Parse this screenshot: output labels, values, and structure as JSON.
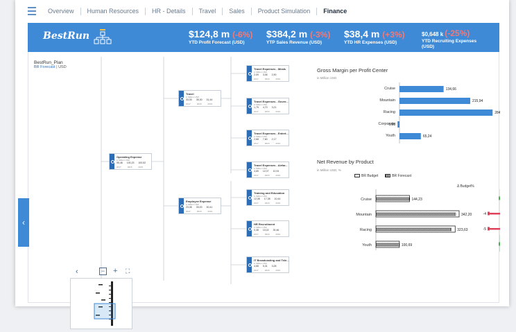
{
  "tabs": [
    "Overview",
    "Human Resources",
    "HR - Details",
    "Travel",
    "Sales",
    "Product Simulation",
    "Finance"
  ],
  "active_tab": "Finance",
  "banner": {
    "logo": "BestRun",
    "kpis": [
      {
        "value": "$124,8 m",
        "delta": "(-6%)",
        "label": "YTD Profit Forecast (USD)"
      },
      {
        "value": "$384,2 m",
        "delta": "(-3%)",
        "label": "YTP Sales Revenue (USD)"
      },
      {
        "value": "$38,4 m",
        "delta": "(+3%)",
        "label": "YTD HR Expenses (USD)"
      },
      {
        "value": "$0,648 k",
        "delta": "(-25%)",
        "label": "YTD Recruiting Expenses (USD)"
      }
    ]
  },
  "plan": {
    "title": "BestRun_Plan",
    "version": "BR Forecast",
    "currency": "USD"
  },
  "tree_nodes": [
    {
      "title": "Operating Expense",
      "sub": "in Million USD",
      "values": [
        "95,46",
        "100,23",
        "100,52"
      ],
      "years": [
        "2017",
        "2018",
        "2019"
      ]
    },
    {
      "title": "Travel",
      "sub": "in Million USD",
      "values": [
        "33,00",
        "35,30",
        "31,44"
      ],
      "years": [
        "2017",
        "2018",
        "2019"
      ]
    },
    {
      "title": "Employee Expense",
      "sub": "in Million USD",
      "values": [
        "23,06",
        "30,00",
        "30,41"
      ],
      "years": [
        "2017",
        "2018",
        "2019"
      ]
    },
    {
      "title": "Travel Expenses - Meals",
      "sub": "in Million USD",
      "values": [
        "2,09",
        "3,06",
        "2,90"
      ],
      "years": [
        "2017",
        "2018",
        "2019"
      ]
    },
    {
      "title": "Travel Expenses - Gover...",
      "sub": "in Million USD",
      "values": [
        "1,75",
        "4,70",
        "3,21"
      ],
      "years": [
        "2017",
        "2018",
        "2019"
      ]
    },
    {
      "title": "Travel Expenses - Entert...",
      "sub": "in Million USD",
      "values": [
        "2,68",
        "7,60",
        "2,17"
      ],
      "years": [
        "2017",
        "2018",
        "2019"
      ]
    },
    {
      "title": "Travel Expenses - Airfar...",
      "sub": "in Million USD",
      "values": [
        "4,65",
        "12,07",
        "10,91"
      ],
      "years": [
        "2017",
        "2018",
        "2019"
      ]
    },
    {
      "title": "Training and Education",
      "sub": "in Million USD",
      "values": [
        "12,08",
        "17,38",
        "10,44"
      ],
      "years": [
        "2017",
        "2018",
        "2019"
      ]
    },
    {
      "title": "HR Recruitment",
      "sub": "in Million USD",
      "values": [
        "0,38",
        "10,02",
        "30,46"
      ],
      "years": [
        "2017",
        "2018",
        "2019"
      ]
    },
    {
      "title": "IT Broadcasting and Tele...",
      "sub": "in Million USD",
      "values": [
        "4,68",
        "5,31",
        "3,28"
      ],
      "years": [
        "2017",
        "2018",
        "2019"
      ]
    }
  ],
  "gross_margin": {
    "title": "Gross Margin per Profit Center",
    "sub": "in Million USD",
    "color": "#3e8ad6"
  },
  "net_revenue": {
    "title": "Net Revenue by Product",
    "sub": "in Million USD, %",
    "legend": [
      "BR Budget",
      "BR Forecast"
    ],
    "delta_header": "Δ Budget%",
    "deltas": [
      "",
      "-4",
      "-5",
      ""
    ]
  },
  "chart_data": [
    {
      "type": "bar",
      "title": "Gross Margin per Profit Center",
      "categories": [
        "Cruise",
        "Mountain",
        "Racing",
        "Corporate",
        "Youth"
      ],
      "values": [
        134.66,
        215.94,
        284.18,
        -5.93,
        65.24
      ],
      "labels": [
        "134,66",
        "215,94",
        "284,18",
        "-5,93",
        "65,24"
      ],
      "xlim": [
        -10,
        290
      ]
    },
    {
      "type": "bar",
      "title": "Net Revenue by Product",
      "categories": [
        "Cruise",
        "Mountain",
        "Racing",
        "Youth"
      ],
      "series": [
        {
          "name": "BR Budget",
          "values": [
            144.23,
            357,
            340,
            100.69
          ]
        },
        {
          "name": "BR Forecast",
          "values": [
            144.23,
            342.2,
            323.63,
            100.69
          ]
        }
      ],
      "labels": [
        "144,23",
        "342,20",
        "323,63",
        "100,69"
      ],
      "xlim": [
        0,
        380
      ]
    }
  ],
  "minimap": {
    "zoom_out": "−",
    "zoom_in": "+",
    "fit": "⛶",
    "back": "‹"
  },
  "nav": {
    "prev": "‹"
  }
}
